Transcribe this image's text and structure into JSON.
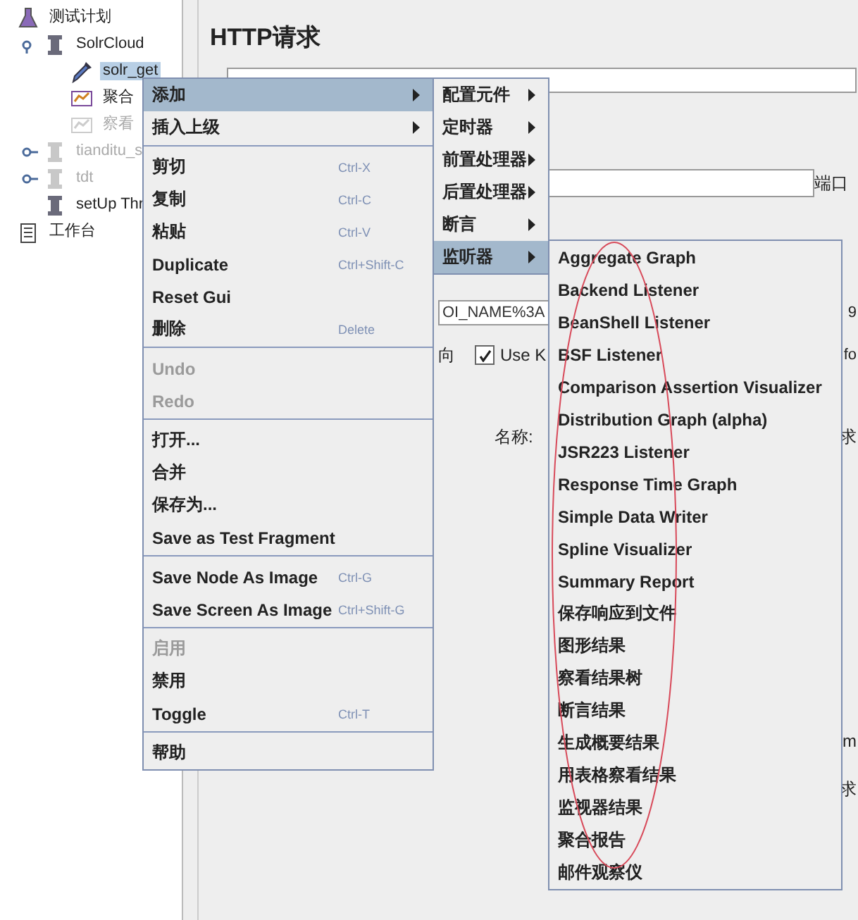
{
  "tree": [
    {
      "label": "测试计划",
      "kind": "plan",
      "selected": false,
      "disabled": false,
      "children": [
        {
          "label": "SolrCloud",
          "kind": "threads",
          "selected": false,
          "disabled": false,
          "expanded": true,
          "children": [
            {
              "label": "solr_get",
              "kind": "sampler",
              "selected": true,
              "disabled": false
            },
            {
              "label": "聚合",
              "kind": "report",
              "selected": false,
              "disabled": false
            },
            {
              "label": "察看",
              "kind": "report",
              "selected": false,
              "disabled": true
            }
          ]
        },
        {
          "label": "tianditu_s",
          "kind": "threads",
          "selected": false,
          "disabled": true,
          "expanded": false
        },
        {
          "label": "tdt",
          "kind": "threads",
          "selected": false,
          "disabled": true,
          "expanded": false
        },
        {
          "label": "setUp Thr",
          "kind": "threads",
          "selected": false,
          "disabled": false
        }
      ]
    },
    {
      "label": "工作台",
      "kind": "workbench",
      "selected": false,
      "disabled": false
    }
  ],
  "panel": {
    "title": "HTTP请求",
    "port_label": "端口",
    "path_field": {
      "value": "OI_NAME%3A"
    },
    "path_field_tail": "9",
    "redirect_tail": "向",
    "keepalive": {
      "label": "Use K",
      "checked": true
    },
    "option_tail": "fo",
    "name_label": "名称:",
    "tail_1": "求",
    "tail_2": "m",
    "tail_3": "求"
  },
  "context_menu": [
    {
      "kind": "item",
      "label": "添加",
      "submenu": true,
      "selected": true,
      "disabled": false
    },
    {
      "kind": "item",
      "label": "插入上级",
      "submenu": true,
      "selected": false,
      "disabled": false
    },
    {
      "kind": "separator"
    },
    {
      "kind": "item",
      "label": "剪切",
      "shortcut": "Ctrl-X",
      "submenu": false,
      "selected": false,
      "disabled": false
    },
    {
      "kind": "item",
      "label": "复制",
      "shortcut": "Ctrl-C",
      "submenu": false,
      "selected": false,
      "disabled": false
    },
    {
      "kind": "item",
      "label": "粘贴",
      "shortcut": "Ctrl-V",
      "submenu": false,
      "selected": false,
      "disabled": false
    },
    {
      "kind": "item",
      "label": "Duplicate",
      "shortcut": "Ctrl+Shift-C",
      "submenu": false,
      "selected": false,
      "disabled": false
    },
    {
      "kind": "item",
      "label": "Reset Gui",
      "submenu": false,
      "selected": false,
      "disabled": false
    },
    {
      "kind": "item",
      "label": "删除",
      "shortcut": "Delete",
      "submenu": false,
      "selected": false,
      "disabled": false
    },
    {
      "kind": "separator"
    },
    {
      "kind": "item",
      "label": "Undo",
      "submenu": false,
      "selected": false,
      "disabled": true
    },
    {
      "kind": "item",
      "label": "Redo",
      "submenu": false,
      "selected": false,
      "disabled": true
    },
    {
      "kind": "separator"
    },
    {
      "kind": "item",
      "label": "打开...",
      "submenu": false,
      "selected": false,
      "disabled": false
    },
    {
      "kind": "item",
      "label": "合并",
      "submenu": false,
      "selected": false,
      "disabled": false
    },
    {
      "kind": "item",
      "label": "保存为...",
      "submenu": false,
      "selected": false,
      "disabled": false
    },
    {
      "kind": "item",
      "label": "Save as Test Fragment",
      "submenu": false,
      "selected": false,
      "disabled": false
    },
    {
      "kind": "separator"
    },
    {
      "kind": "item",
      "label": "Save Node As Image",
      "shortcut": "Ctrl-G",
      "submenu": false,
      "selected": false,
      "disabled": false
    },
    {
      "kind": "item",
      "label": "Save Screen As Image",
      "shortcut": "Ctrl+Shift-G",
      "submenu": false,
      "selected": false,
      "disabled": false
    },
    {
      "kind": "separator"
    },
    {
      "kind": "item",
      "label": "启用",
      "submenu": false,
      "selected": false,
      "disabled": true
    },
    {
      "kind": "item",
      "label": "禁用",
      "submenu": false,
      "selected": false,
      "disabled": false
    },
    {
      "kind": "item",
      "label": "Toggle",
      "shortcut": "Ctrl-T",
      "submenu": false,
      "selected": false,
      "disabled": false
    },
    {
      "kind": "separator"
    },
    {
      "kind": "item",
      "label": "帮助",
      "submenu": false,
      "selected": false,
      "disabled": false
    }
  ],
  "add_submenu": [
    {
      "kind": "item",
      "label": "配置元件",
      "submenu": true,
      "selected": false,
      "disabled": false
    },
    {
      "kind": "item",
      "label": "定时器",
      "submenu": true,
      "selected": false,
      "disabled": false
    },
    {
      "kind": "item",
      "label": "前置处理器",
      "submenu": true,
      "selected": false,
      "disabled": false
    },
    {
      "kind": "item",
      "label": "后置处理器",
      "submenu": true,
      "selected": false,
      "disabled": false
    },
    {
      "kind": "item",
      "label": "断言",
      "submenu": true,
      "selected": false,
      "disabled": false
    },
    {
      "kind": "item",
      "label": "监听器",
      "submenu": true,
      "selected": true,
      "disabled": false
    }
  ],
  "listener_submenu": [
    {
      "kind": "item",
      "label": "Aggregate Graph",
      "submenu": false,
      "selected": false,
      "disabled": false
    },
    {
      "kind": "item",
      "label": "Backend Listener",
      "submenu": false,
      "selected": false,
      "disabled": false
    },
    {
      "kind": "item",
      "label": "BeanShell Listener",
      "submenu": false,
      "selected": false,
      "disabled": false
    },
    {
      "kind": "item",
      "label": "BSF Listener",
      "submenu": false,
      "selected": false,
      "disabled": false
    },
    {
      "kind": "item",
      "label": "Comparison Assertion Visualizer",
      "submenu": false,
      "selected": false,
      "disabled": false
    },
    {
      "kind": "item",
      "label": "Distribution Graph (alpha)",
      "submenu": false,
      "selected": false,
      "disabled": false
    },
    {
      "kind": "item",
      "label": "JSR223 Listener",
      "submenu": false,
      "selected": false,
      "disabled": false
    },
    {
      "kind": "item",
      "label": "Response Time Graph",
      "submenu": false,
      "selected": false,
      "disabled": false
    },
    {
      "kind": "item",
      "label": "Simple Data Writer",
      "submenu": false,
      "selected": false,
      "disabled": false
    },
    {
      "kind": "item",
      "label": "Spline Visualizer",
      "submenu": false,
      "selected": false,
      "disabled": false
    },
    {
      "kind": "item",
      "label": "Summary Report",
      "submenu": false,
      "selected": false,
      "disabled": false
    },
    {
      "kind": "item",
      "label": "保存响应到文件",
      "submenu": false,
      "selected": false,
      "disabled": false
    },
    {
      "kind": "item",
      "label": "图形结果",
      "submenu": false,
      "selected": false,
      "disabled": false
    },
    {
      "kind": "item",
      "label": "察看结果树",
      "submenu": false,
      "selected": false,
      "disabled": false
    },
    {
      "kind": "item",
      "label": "断言结果",
      "submenu": false,
      "selected": false,
      "disabled": false
    },
    {
      "kind": "item",
      "label": "生成概要结果",
      "submenu": false,
      "selected": false,
      "disabled": false
    },
    {
      "kind": "item",
      "label": "用表格察看结果",
      "submenu": false,
      "selected": false,
      "disabled": false
    },
    {
      "kind": "item",
      "label": "监视器结果",
      "submenu": false,
      "selected": false,
      "disabled": false
    },
    {
      "kind": "item",
      "label": "聚合报告",
      "submenu": false,
      "selected": false,
      "disabled": false
    },
    {
      "kind": "item",
      "label": "邮件观察仪",
      "submenu": false,
      "selected": false,
      "disabled": false
    }
  ]
}
